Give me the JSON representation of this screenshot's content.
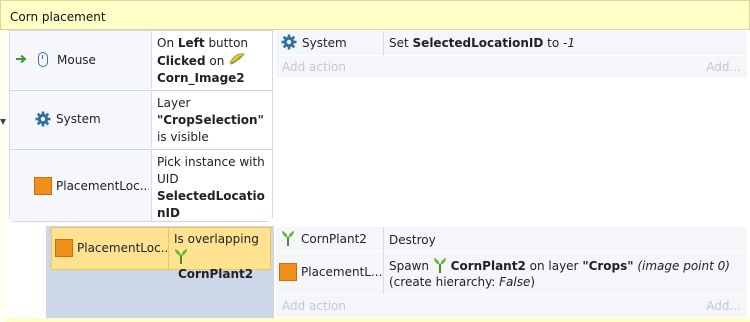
{
  "group": {
    "title": "Corn placement"
  },
  "event1": {
    "conditions": [
      {
        "object": "Mouse",
        "icon": "mouse-icon",
        "text_parts": [
          "On ",
          "Left",
          " button ",
          "Clicked",
          " on ",
          "Corn_Image2"
        ]
      },
      {
        "object": "System",
        "icon": "gear-icon",
        "text_parts": [
          "Layer ",
          "\"CropSelection\"",
          " is visible"
        ]
      },
      {
        "object": "PlacementLoc...",
        "icon": "orange-square-icon",
        "text_parts": [
          "Pick instance with UID ",
          "SelectedLocationID"
        ]
      }
    ],
    "actions": [
      {
        "object": "System",
        "icon": "gear-icon",
        "text_parts": [
          "Set ",
          "SelectedLocationID",
          " to ",
          "-1"
        ]
      }
    ],
    "add_action": {
      "label": "Add action",
      "more": "Add..."
    }
  },
  "event2": {
    "condition": {
      "object": "PlacementLoc...",
      "icon": "orange-square-icon",
      "text_parts": [
        "Is overlapping",
        "CornPlant2"
      ]
    },
    "actions": [
      {
        "object": "CornPlant2",
        "icon": "sprout-icon",
        "text_parts": [
          "Destroy"
        ]
      },
      {
        "object": "PlacementL...",
        "icon": "orange-square-icon",
        "text_parts": [
          "Spawn ",
          "CornPlant2",
          " on layer ",
          "\"Crops\"",
          " (image point 0)",
          "(create hierarchy: ",
          "False",
          ")"
        ]
      }
    ],
    "add_action": {
      "label": "Add action",
      "more": "Add..."
    }
  },
  "colors": {
    "group_header": "#ffffc6",
    "condition_column": "#ccd7e8",
    "selected_condition": "#ffe391",
    "object_orange": "#f0901c",
    "accent_blue": "#3b6fb0",
    "trigger_green": "#3a9a3a"
  }
}
